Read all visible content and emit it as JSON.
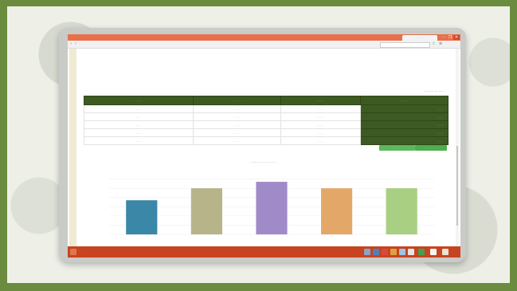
{
  "browser": {
    "tab_label": "· · · · · · ·",
    "address": "· · · · · · · · · · ·",
    "window_buttons": [
      "–",
      "❐",
      "✕"
    ]
  },
  "page": {
    "section_title": "· · · · · · · · · ·"
  },
  "table": {
    "headers": [
      "· · · · ·",
      "· · · · ·",
      "· · · · ·",
      "· · · · ·"
    ],
    "rows": [
      [
        "· · · ·",
        "· · · ·",
        "· · · ·",
        "· · · ·"
      ],
      [
        "· · · ·",
        "· · · ·",
        "· · · ·",
        "· · · ·"
      ],
      [
        "· · · ·",
        "· · · ·",
        "· · · ·",
        "· · · ·"
      ],
      [
        "· · · ·",
        "· · · ·",
        "· · · ·",
        "· · · ·"
      ],
      [
        "· · · ·",
        "· · · ·",
        "· · · ·",
        "· · · ·"
      ]
    ]
  },
  "buttons": {
    "btn1": "· · · · · · · ·",
    "btn2": "· · · · · · · ·"
  },
  "chart": {
    "title": "· · · · · · · · · · · · ·"
  },
  "chart_data": {
    "type": "bar",
    "title": "",
    "categories": [
      "",
      "",
      "",
      "",
      ""
    ],
    "values": [
      37,
      50,
      57,
      50,
      50
    ],
    "colors": [
      "#3a87a8",
      "#b8b48a",
      "#a08bc8",
      "#e3a868",
      "#a8cf82"
    ],
    "ylim": [
      0,
      70
    ],
    "grid": true
  },
  "taskbar": {
    "start_text": "· · · · ·"
  }
}
